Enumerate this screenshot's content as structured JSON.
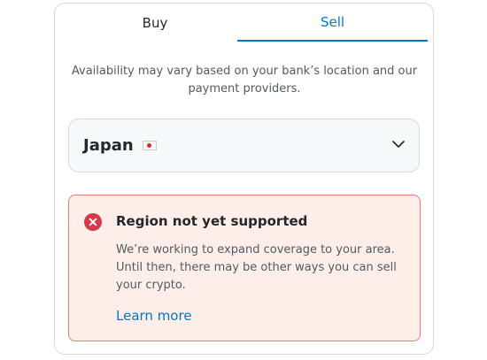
{
  "tabs": [
    {
      "label": "Buy",
      "active": false
    },
    {
      "label": "Sell",
      "active": true
    }
  ],
  "notice": "Availability may vary based on your bank’s location and our payment providers.",
  "region_select": {
    "selected": "Japan",
    "flag_icon": "japan-flag-icon",
    "chevron_icon": "chevron-down-icon"
  },
  "alert": {
    "icon": "error-x-icon",
    "title": "Region not yet supported",
    "body": "We’re working to expand coverage to your area. Until then, there may be other ways you can sell your crypto.",
    "link": "Learn more"
  },
  "colors": {
    "accent": "#0376c9",
    "error": "#d73847",
    "alert_bg": "#fdeeea",
    "alert_border": "#e77c72"
  }
}
